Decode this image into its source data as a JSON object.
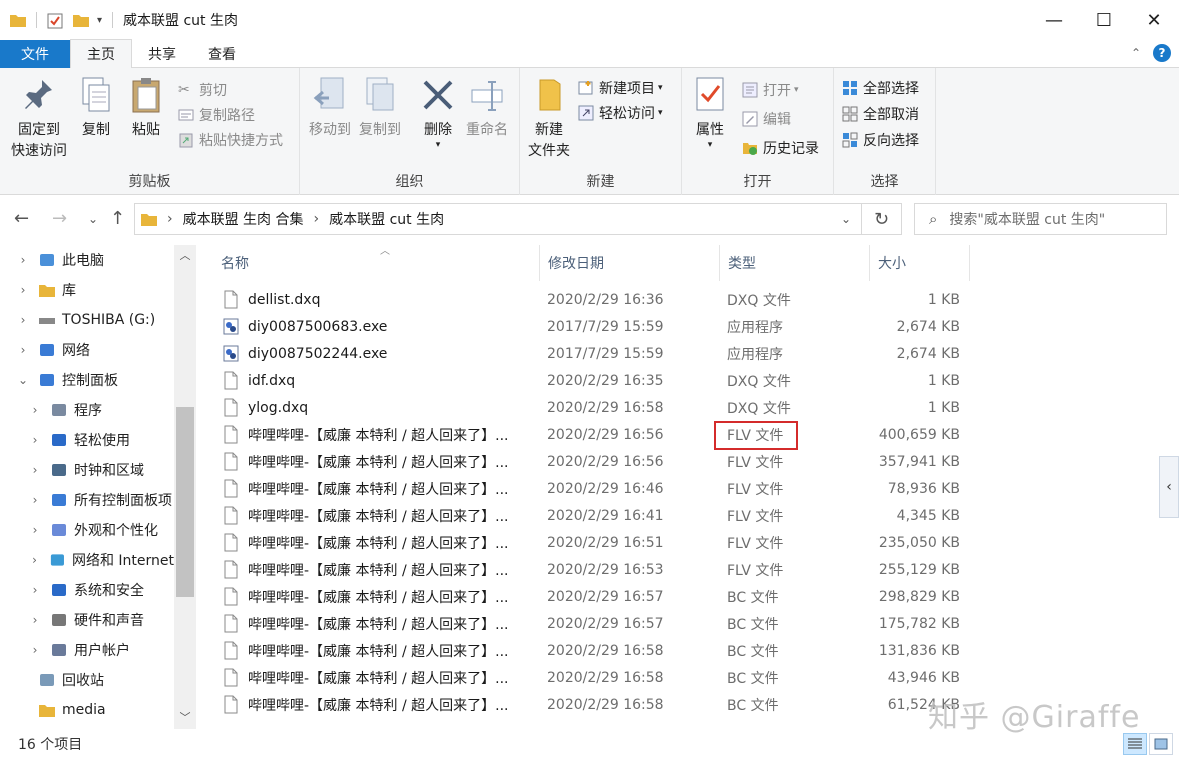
{
  "window": {
    "title": "威本联盟 cut 生肉",
    "minimize": "—",
    "maximize": "☐",
    "close": "✕"
  },
  "tabs": [
    {
      "label": "文件"
    },
    {
      "label": "主页"
    },
    {
      "label": "共享"
    },
    {
      "label": "查看"
    }
  ],
  "ribbon": {
    "clipboard": {
      "label": "剪贴板",
      "pin_line1": "固定到",
      "pin_line2": "快速访问",
      "copy": "复制",
      "paste": "粘贴",
      "cut": "剪切",
      "copy_path": "复制路径",
      "paste_shortcut": "粘贴快捷方式"
    },
    "organize": {
      "label": "组织",
      "move_to": "移动到",
      "copy_to": "复制到",
      "delete": "删除",
      "rename": "重命名"
    },
    "new": {
      "label": "新建",
      "new_folder_line1": "新建",
      "new_folder_line2": "文件夹",
      "new_item": "新建项目",
      "easy_access": "轻松访问"
    },
    "open": {
      "label": "打开",
      "properties": "属性",
      "open": "打开",
      "edit": "编辑",
      "history": "历史记录"
    },
    "select": {
      "label": "选择",
      "select_all": "全部选择",
      "select_none": "全部取消",
      "invert": "反向选择"
    }
  },
  "address": {
    "crumb1": "威本联盟 生肉 合集",
    "crumb2": "威本联盟 cut 生肉",
    "sep": "›",
    "search_placeholder": "搜索\"威本联盟 cut 生肉\""
  },
  "nav_tree": [
    {
      "label": "此电脑",
      "icon": "computer-icon",
      "expand": "›"
    },
    {
      "label": "库",
      "icon": "library-icon",
      "expand": "›"
    },
    {
      "label": "TOSHIBA (G:)",
      "icon": "drive-icon",
      "expand": "›"
    },
    {
      "label": "网络",
      "icon": "network-icon",
      "expand": "›"
    },
    {
      "label": "控制面板",
      "icon": "control-panel-icon",
      "expand": "⌄"
    },
    {
      "label": "程序",
      "icon": "programs-icon",
      "expand": "›"
    },
    {
      "label": "轻松使用",
      "icon": "ease-of-access-icon",
      "expand": "›"
    },
    {
      "label": "时钟和区域",
      "icon": "clock-icon",
      "expand": "›"
    },
    {
      "label": "所有控制面板项",
      "icon": "all-control-panel-icon",
      "expand": "›"
    },
    {
      "label": "外观和个性化",
      "icon": "appearance-icon",
      "expand": "›"
    },
    {
      "label": "网络和 Internet",
      "icon": "network-internet-icon",
      "expand": "›"
    },
    {
      "label": "系统和安全",
      "icon": "security-icon",
      "expand": "›"
    },
    {
      "label": "硬件和声音",
      "icon": "hardware-icon",
      "expand": "›"
    },
    {
      "label": "用户帐户",
      "icon": "user-accounts-icon",
      "expand": "›"
    },
    {
      "label": "回收站",
      "icon": "recycle-bin-icon",
      "expand": ""
    },
    {
      "label": "media",
      "icon": "folder-icon",
      "expand": ""
    }
  ],
  "columns": {
    "name": "名称",
    "date": "修改日期",
    "type": "类型",
    "size": "大小"
  },
  "files": [
    {
      "name": "dellist.dxq",
      "date": "2020/2/29 16:36",
      "type": "DXQ 文件",
      "size": "1 KB",
      "icon": "file-icon"
    },
    {
      "name": "diy0087500683.exe",
      "date": "2017/7/29 15:59",
      "type": "应用程序",
      "size": "2,674 KB",
      "icon": "exe-icon"
    },
    {
      "name": "diy0087502244.exe",
      "date": "2017/7/29 15:59",
      "type": "应用程序",
      "size": "2,674 KB",
      "icon": "exe-icon"
    },
    {
      "name": "idf.dxq",
      "date": "2020/2/29 16:35",
      "type": "DXQ 文件",
      "size": "1 KB",
      "icon": "file-icon"
    },
    {
      "name": "ylog.dxq",
      "date": "2020/2/29 16:58",
      "type": "DXQ 文件",
      "size": "1 KB",
      "icon": "file-icon"
    },
    {
      "name": "哔哩哔哩-【威廉 本特利 / 超人回来了】...",
      "date": "2020/2/29 16:56",
      "type": "FLV 文件",
      "size": "400,659 KB",
      "icon": "file-icon"
    },
    {
      "name": "哔哩哔哩-【威廉 本特利 / 超人回来了】...",
      "date": "2020/2/29 16:56",
      "type": "FLV 文件",
      "size": "357,941 KB",
      "icon": "file-icon"
    },
    {
      "name": "哔哩哔哩-【威廉 本特利 / 超人回来了】...",
      "date": "2020/2/29 16:46",
      "type": "FLV 文件",
      "size": "78,936 KB",
      "icon": "file-icon"
    },
    {
      "name": "哔哩哔哩-【威廉 本特利 / 超人回来了】...",
      "date": "2020/2/29 16:41",
      "type": "FLV 文件",
      "size": "4,345 KB",
      "icon": "file-icon"
    },
    {
      "name": "哔哩哔哩-【威廉 本特利 / 超人回来了】...",
      "date": "2020/2/29 16:51",
      "type": "FLV 文件",
      "size": "235,050 KB",
      "icon": "file-icon"
    },
    {
      "name": "哔哩哔哩-【威廉 本特利 / 超人回来了】...",
      "date": "2020/2/29 16:53",
      "type": "FLV 文件",
      "size": "255,129 KB",
      "icon": "file-icon"
    },
    {
      "name": "哔哩哔哩-【威廉 本特利 / 超人回来了】...",
      "date": "2020/2/29 16:57",
      "type": "BC 文件",
      "size": "298,829 KB",
      "icon": "file-icon"
    },
    {
      "name": "哔哩哔哩-【威廉 本特利 / 超人回来了】...",
      "date": "2020/2/29 16:57",
      "type": "BC 文件",
      "size": "175,782 KB",
      "icon": "file-icon"
    },
    {
      "name": "哔哩哔哩-【威廉 本特利 / 超人回来了】...",
      "date": "2020/2/29 16:58",
      "type": "BC 文件",
      "size": "131,836 KB",
      "icon": "file-icon"
    },
    {
      "name": "哔哩哔哩-【威廉 本特利 / 超人回来了】...",
      "date": "2020/2/29 16:58",
      "type": "BC 文件",
      "size": "43,946 KB",
      "icon": "file-icon"
    },
    {
      "name": "哔哩哔哩-【威廉 本特利 / 超人回来了】...",
      "date": "2020/2/29 16:58",
      "type": "BC 文件",
      "size": "61,524 KB",
      "icon": "file-icon"
    }
  ],
  "status": {
    "item_count": "16 个项目"
  },
  "watermark": "知乎 @Giraffe",
  "colors": {
    "accent": "#1979ca",
    "highlight_border": "#d42b2b"
  }
}
